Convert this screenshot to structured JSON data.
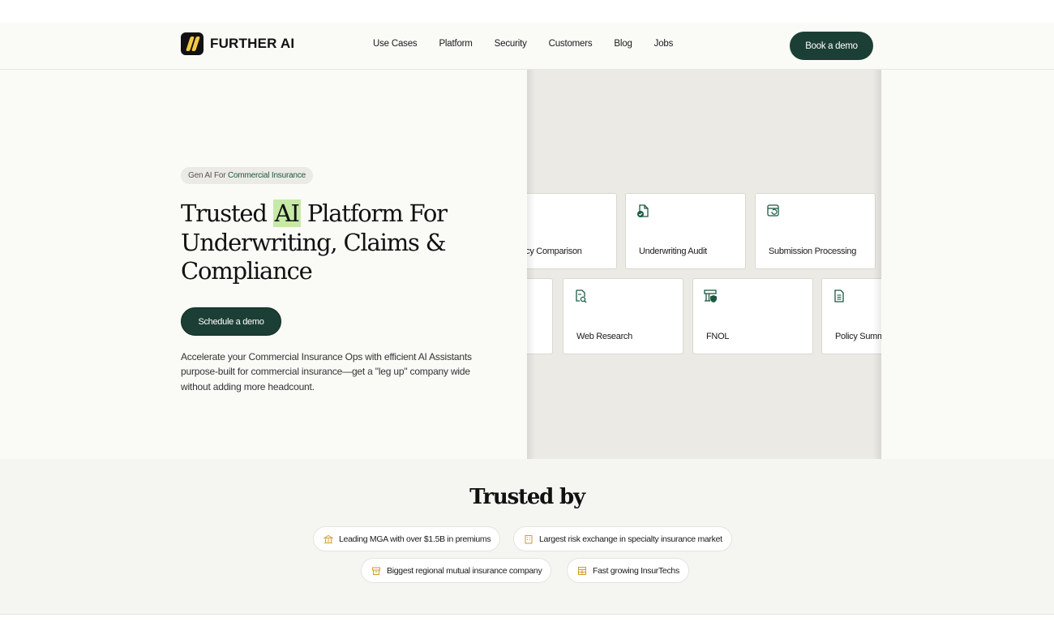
{
  "brand": {
    "name": "FURTHER AI"
  },
  "nav": {
    "links": [
      "Use Cases",
      "Platform",
      "Security",
      "Customers",
      "Blog",
      "Jobs"
    ],
    "cta": "Book a demo"
  },
  "hero": {
    "badge_prefix": "Gen AI For",
    "badge_accent": "Commercial Insurance",
    "headline_part1": "Trusted",
    "headline_highlight": "AI",
    "headline_part2": "Platform For Underwriting, Claims & Compliance",
    "cta": "Schedule a demo",
    "subtext": "Accelerate your Commercial Insurance Ops with efficient AI Assistants purpose-built for commercial insurance—get a \"leg up\" company wide without adding more headcount."
  },
  "cards": [
    {
      "label": "Policy Comparison",
      "icon": "compare-icon"
    },
    {
      "label": "Underwriting Audit",
      "icon": "document-check-icon"
    },
    {
      "label": "Submission Processing",
      "icon": "refresh-window-icon"
    },
    {
      "label": "",
      "icon": ""
    },
    {
      "label": "Web Research",
      "icon": "document-search-icon"
    },
    {
      "label": "FNOL",
      "icon": "shield-building-icon"
    },
    {
      "label": "Policy Summary",
      "icon": "document-lines-icon"
    }
  ],
  "trusted": {
    "title": "Trusted by",
    "pills": [
      {
        "text": "Leading MGA with over $1.5B in premiums",
        "icon": "bank-icon"
      },
      {
        "text": "Largest risk exchange in specialty insurance market",
        "icon": "building-icon"
      },
      {
        "text": "Biggest regional mutual insurance company",
        "icon": "archive-icon"
      },
      {
        "text": "Fast growing InsurTechs",
        "icon": "grid-building-icon"
      }
    ]
  },
  "colors": {
    "primary": "#1c3f35",
    "highlight": "#c6e9a7",
    "accent_text": "#1c5a40",
    "pill_icon": "#d19a2a",
    "hero_panel": "#ebeae5"
  }
}
